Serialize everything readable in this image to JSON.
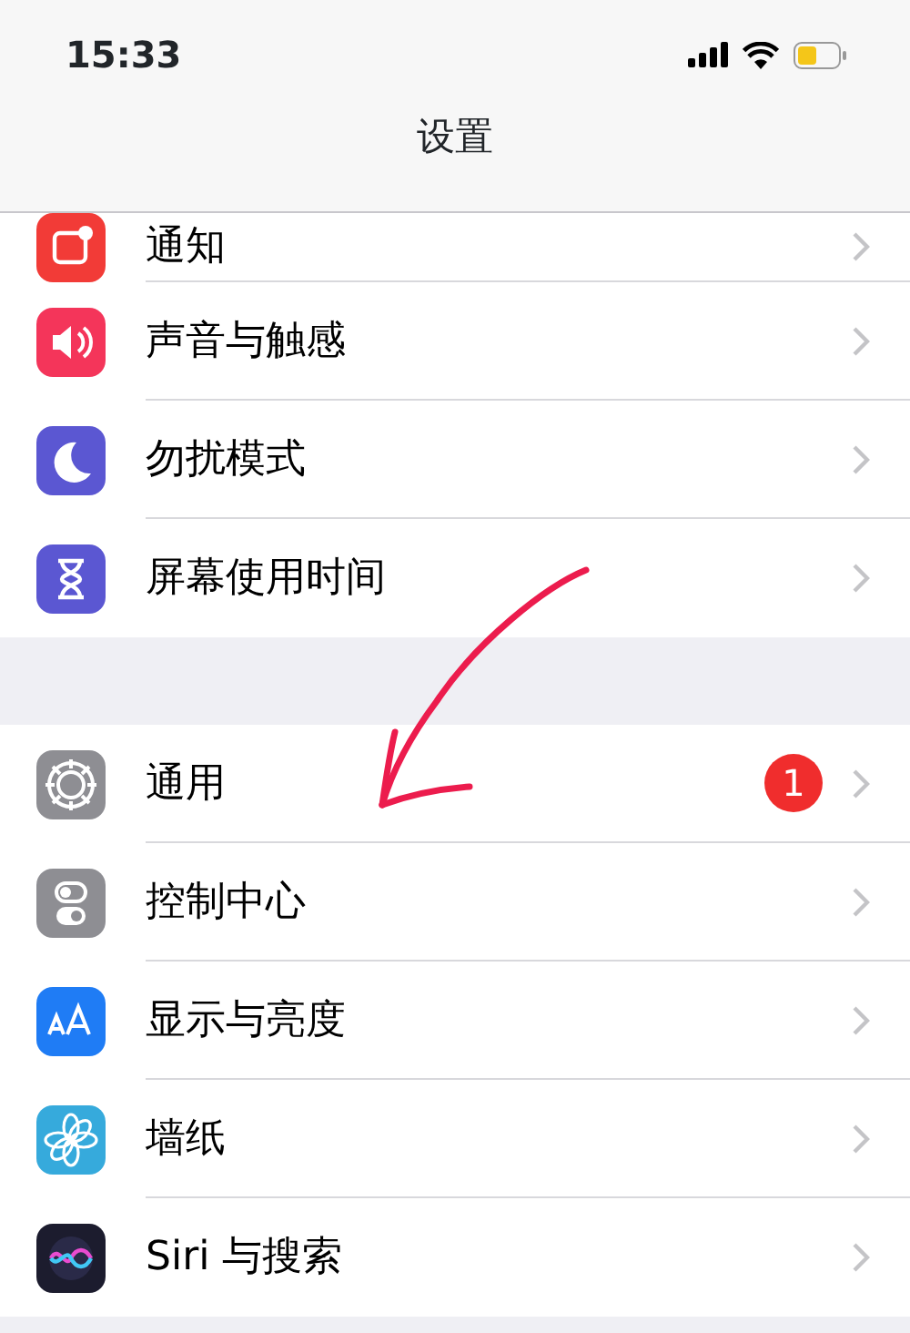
{
  "status_bar": {
    "time": "15:33"
  },
  "nav": {
    "title": "设置"
  },
  "sections": [
    {
      "rows": [
        {
          "label": "通知",
          "kind": "notice",
          "color": "#f23b37"
        },
        {
          "label": "声音与触感",
          "kind": "sound",
          "color": "#f4355a"
        },
        {
          "label": "勿扰模式",
          "kind": "moon",
          "color": "#5b57d2"
        },
        {
          "label": "屏幕使用时间",
          "kind": "hourglass",
          "color": "#5b57d2"
        }
      ]
    },
    {
      "rows": [
        {
          "label": "通用",
          "kind": "gear",
          "color": "#8e8e93",
          "badge": "1"
        },
        {
          "label": "控制中心",
          "kind": "toggles",
          "color": "#8e8e93"
        },
        {
          "label": "显示与亮度",
          "kind": "aa",
          "color": "#1f7cf5"
        },
        {
          "label": "墙纸",
          "kind": "flower",
          "color": "#36aadc"
        },
        {
          "label": "Siri 与搜索",
          "kind": "siri",
          "color": "#1c1c2e"
        }
      ]
    }
  ]
}
